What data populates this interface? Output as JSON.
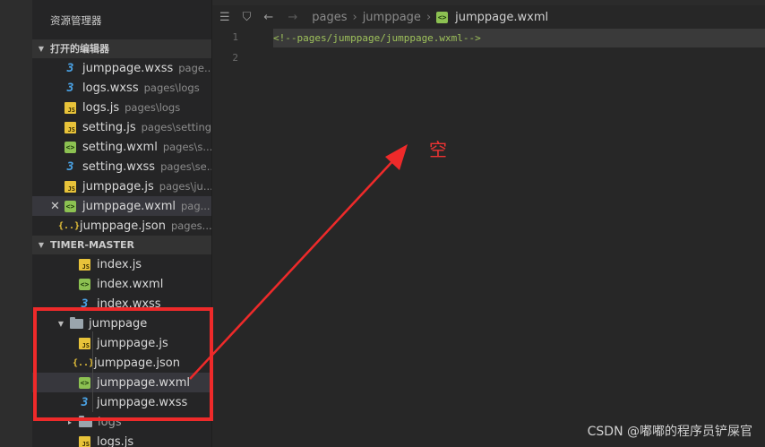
{
  "explorer": {
    "title": "资源管理器",
    "open_editors": {
      "label": "打开的编辑器",
      "items": [
        {
          "name": "jumppage.wxss",
          "desc": "page...",
          "icon": "css-file-icon"
        },
        {
          "name": "logs.wxss",
          "desc": "pages\\logs",
          "icon": "css-file-icon"
        },
        {
          "name": "logs.js",
          "desc": "pages\\logs",
          "icon": "js-file-icon"
        },
        {
          "name": "setting.js",
          "desc": "pages\\setting",
          "icon": "js-file-icon"
        },
        {
          "name": "setting.wxml",
          "desc": "pages\\s...",
          "icon": "wxml-file-icon"
        },
        {
          "name": "setting.wxss",
          "desc": "pages\\se...",
          "icon": "css-file-icon"
        },
        {
          "name": "jumppage.js",
          "desc": "pages\\ju...",
          "icon": "js-file-icon"
        },
        {
          "name": "jumppage.wxml",
          "desc": "pag...",
          "icon": "wxml-file-icon"
        },
        {
          "name": "jumppage.json",
          "desc": "pages...",
          "icon": "json-file-icon"
        }
      ],
      "close_glyph": "✕"
    },
    "project": {
      "label": "TIMER-MASTER",
      "index_files": [
        "index.js",
        "index.wxml",
        "index.wxss"
      ],
      "folder": "jumppage",
      "folder_files": [
        "jumppage.js",
        "jumppage.json",
        "jumppage.wxml",
        "jumppage.wxss"
      ],
      "logs_folder": "logs",
      "logs_files": [
        "logs.js"
      ]
    }
  },
  "breadcrumb": {
    "parts": [
      "pages",
      "jumppage"
    ],
    "current": "jumppage.wxml"
  },
  "editor": {
    "line_numbers": [
      "1",
      "2"
    ],
    "line1": "<!--pages/jumppage/jumppage.wxml-->"
  },
  "annotation": {
    "text": "空",
    "color": "#e83333"
  },
  "watermark": "CSDN @嘟嘟的程序员铲屎官",
  "colors": {
    "js_icon": "#e8c33a",
    "wxml_icon": "#8cc152",
    "wxss_icon": "#4aa3e6",
    "comment": "#9ec15b"
  }
}
